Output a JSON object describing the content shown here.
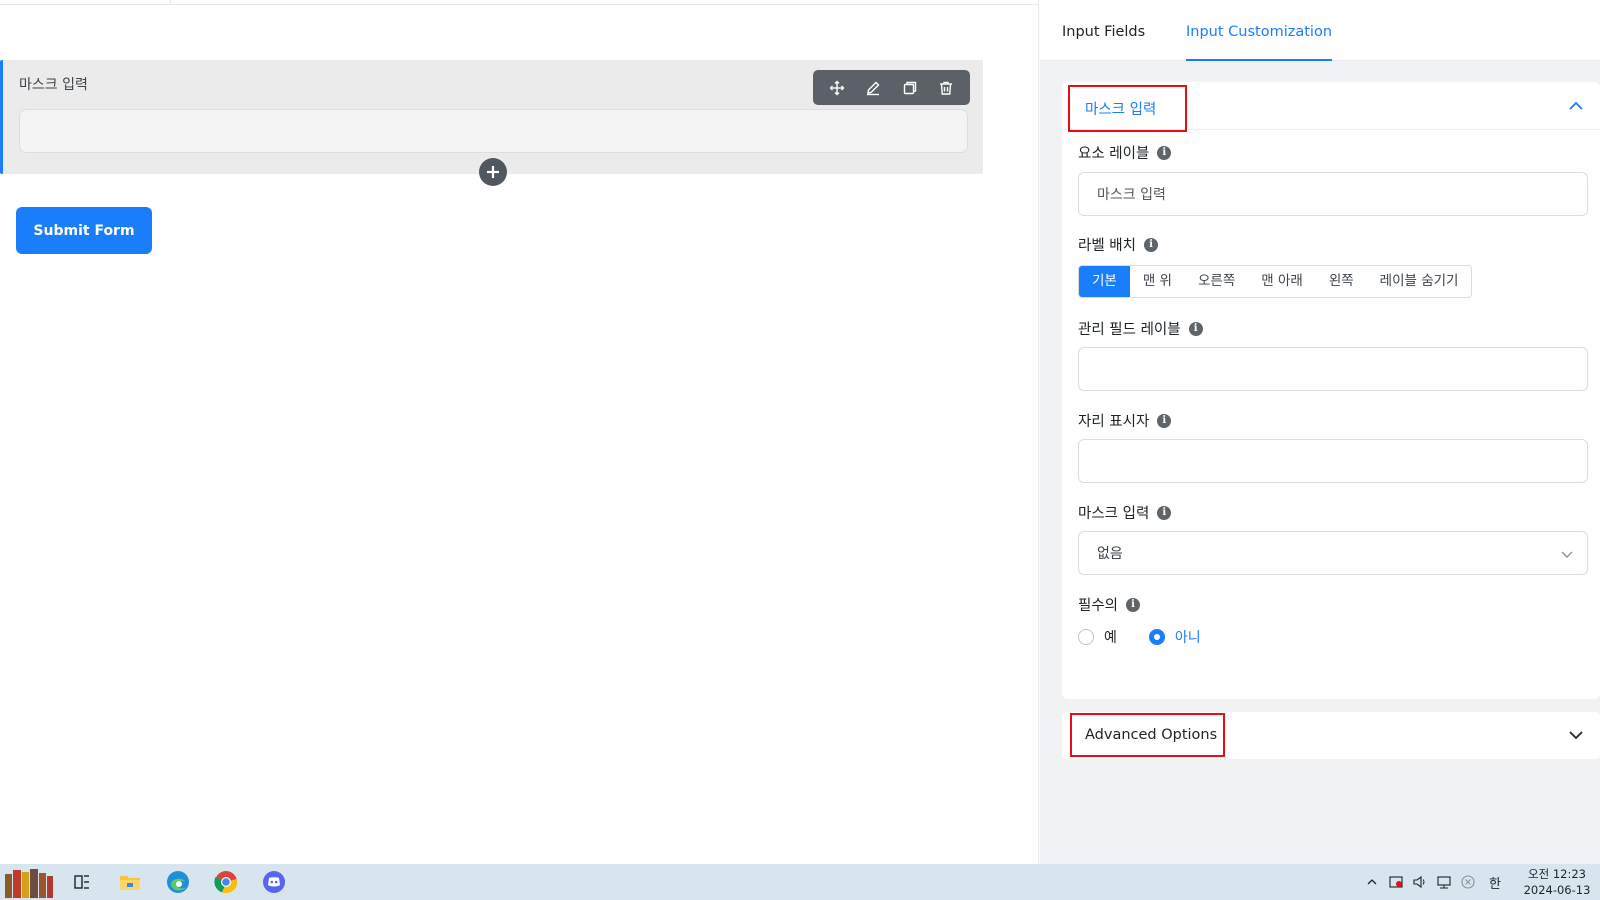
{
  "canvas": {
    "field": {
      "label": "마스크 입력"
    },
    "submit_label": "Submit Form"
  },
  "panel": {
    "tabs": [
      {
        "label": "Input Fields"
      },
      {
        "label": "Input Customization"
      }
    ],
    "section": {
      "title": "마스크 입력",
      "element_label": {
        "label": "요소 레이블",
        "value": "마스크 입력"
      },
      "label_placement": {
        "label": "라벨 배치",
        "options": [
          "기본",
          "맨 위",
          "오른쪽",
          "맨 아래",
          "왼쪽",
          "레이블 숨기기"
        ],
        "selected": "기본"
      },
      "admin_label": {
        "label": "관리 필드 레이블",
        "value": ""
      },
      "placeholder": {
        "label": "자리 표시자",
        "value": ""
      },
      "mask_input": {
        "label": "마스크 입력",
        "value": "없음"
      },
      "required": {
        "label": "필수의",
        "options": [
          "예",
          "아니"
        ],
        "selected": "아니"
      }
    },
    "advanced": {
      "title": "Advanced Options"
    }
  },
  "taskbar": {
    "clock": {
      "time": "오전 12:23",
      "date": "2024-06-13"
    },
    "ime": "한"
  },
  "colors": {
    "accent": "#1a7efb",
    "highlight_box": "#e3101a",
    "panel_bg": "#f1f2f4"
  }
}
